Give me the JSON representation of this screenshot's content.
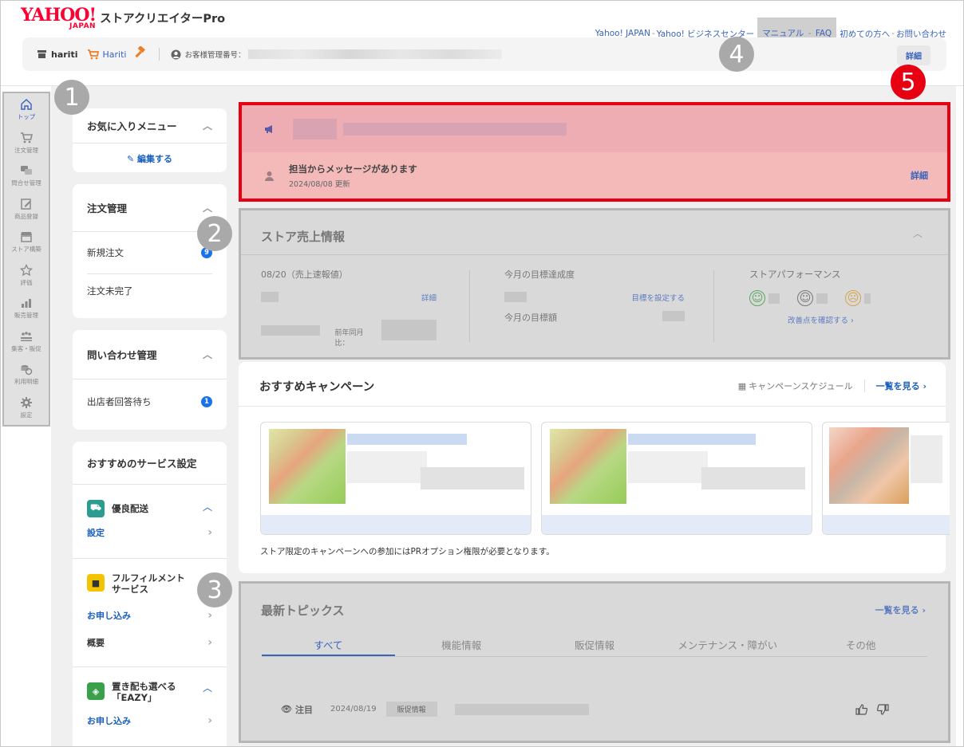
{
  "header": {
    "logo_text": "YAHOO!",
    "logo_japan": "JAPAN",
    "app_name": "ストアクリエイターPro",
    "links": [
      "Yahoo! JAPAN",
      "Yahoo! ビジネスセンター",
      "マニュアル",
      "FAQ",
      "初めての方へ",
      "お問い合わせ"
    ],
    "separator": "-",
    "store_name": "hariti",
    "store_link": "Hariti",
    "customer_no_label": "お客様管理番号：",
    "detail_button": "詳細"
  },
  "badges": {
    "b1": "1",
    "b2": "2",
    "b3": "3",
    "b4": "4",
    "b5": "5"
  },
  "left_nav": [
    {
      "label": "トップ",
      "icon": "home-icon"
    },
    {
      "label": "注文管理",
      "icon": "cart-icon"
    },
    {
      "label": "問合せ管理",
      "icon": "chat-icon"
    },
    {
      "label": "商品登録",
      "icon": "edit-icon"
    },
    {
      "label": "ストア構築",
      "icon": "store-icon"
    },
    {
      "label": "評価",
      "icon": "star-icon"
    },
    {
      "label": "販売管理",
      "icon": "bar-chart-icon"
    },
    {
      "label": "集客・販促",
      "icon": "promotion-icon"
    },
    {
      "label": "利用明細",
      "icon": "coins-icon"
    },
    {
      "label": "設定",
      "icon": "gear-icon"
    }
  ],
  "favorites": {
    "title": "お気に入りメニュー",
    "edit": "編集する"
  },
  "orders": {
    "title": "注文管理",
    "items": [
      {
        "label": "新規注文",
        "count": "9"
      },
      {
        "label": "注文未完了",
        "count": ""
      }
    ]
  },
  "inquiries": {
    "title": "問い合わせ管理",
    "items": [
      {
        "label": "出店者回答待ち",
        "count": "1"
      }
    ]
  },
  "services": {
    "title": "おすすめのサービス設定",
    "s1": {
      "name": "優良配送",
      "link": "設定"
    },
    "s2": {
      "name_l1": "フルフィルメント",
      "name_l2": "サービス",
      "link": "お申し込み",
      "link2": "概要"
    },
    "s3": {
      "name_l1": "置き配も選べる",
      "name_l2": "「EAZY」",
      "link": "お申し込み"
    }
  },
  "notice": {
    "message": "担当からメッセージがあります",
    "date": "2024/08/08 更新",
    "detail": "詳細"
  },
  "sales": {
    "title": "ストア売上情報",
    "date_label": "08/20（売上速報値）",
    "detail": "詳細",
    "yoy_label": "前年同月比：",
    "goal_rate_label": "今月の目標達成度",
    "set_goal": "目標を設定する",
    "goal_amount_label": "今月の目標額",
    "performance_label": "ストアパフォーマンス",
    "improve_link": "改善点を確認する ›"
  },
  "campaigns": {
    "title": "おすすめキャンペーン",
    "schedule": "キャンペーンスケジュール",
    "see_all": "一覧を見る ›",
    "note": "ストア限定のキャンペーンへの参加にはPRオプション権限が必要となります。"
  },
  "topics": {
    "title": "最新トピックス",
    "see_all": "一覧を見る ›",
    "tabs": [
      "すべて",
      "機能情報",
      "販促情報",
      "メンテナンス・障がい",
      "その他"
    ],
    "row": {
      "tag": "注目",
      "date": "2024/08/19",
      "category": "販促情報"
    }
  },
  "colors": {
    "accent": "#3a63bb",
    "brand": "#ff0033",
    "alert": "#e60012"
  }
}
